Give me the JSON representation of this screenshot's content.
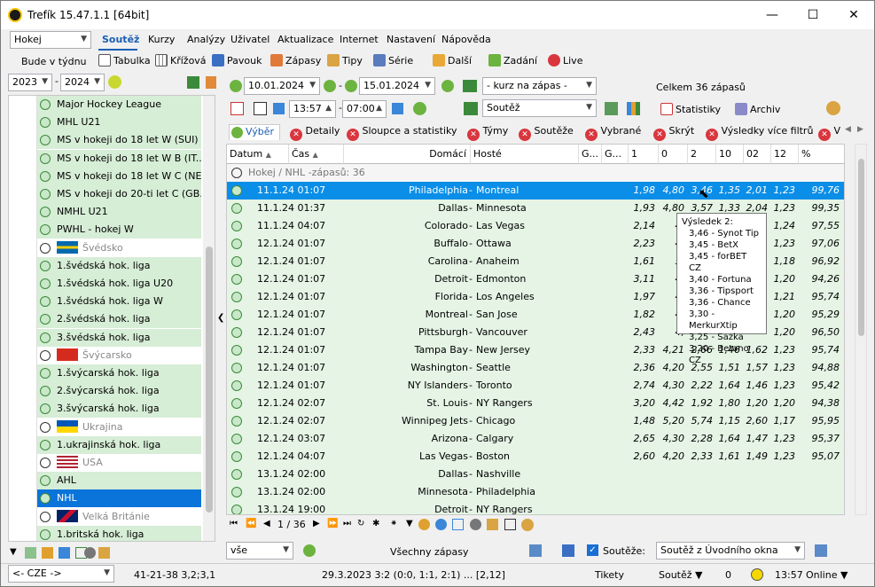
{
  "window": {
    "title": "Trefík 15.47.1.1 [64bit]",
    "minimize": "—",
    "maximize": "☐",
    "close": "✕"
  },
  "sport_select": "Hokej",
  "period_label": "Bude v týdnu",
  "menu": [
    "Soutěž",
    "Kurzy",
    "Analýzy",
    "Uživatel",
    "Aktualizace",
    "Internet",
    "Nastavení",
    "Nápověda"
  ],
  "toolbar1": [
    "Tabulka",
    "Křížová",
    "Pavouk",
    "Zápasy",
    "Tipy",
    "Série",
    "Další",
    "Zadání",
    "Live"
  ],
  "year_from": "2023",
  "year_to": "2024",
  "date_from": "10.01.2024",
  "date_to": "15.01.2024",
  "time_from": "13:57",
  "time_to": "07:00",
  "kurz_select": "- kurz na zápas -",
  "souteze_select": "Soutěž",
  "total_label": "Celkem 36 zápasů",
  "statistiky": "Statistiky",
  "archiv": "Archiv",
  "filters": [
    "Výběr",
    "Detaily",
    "Sloupce a statistiky",
    "Týmy",
    "Soutěže",
    "Vybrané",
    "Skrýt",
    "Výsledky více filtrů",
    "V"
  ],
  "left_list": [
    {
      "label": "Major Hockey League",
      "type": "league"
    },
    {
      "label": "MHL U21",
      "type": "league"
    },
    {
      "label": "MS v hokeji do 18 let W (SUI)",
      "type": "league"
    },
    {
      "label": "MS v hokeji do 18 let W B (IT...",
      "type": "league"
    },
    {
      "label": "MS v hokeji do 18 let W C (NE...",
      "type": "league"
    },
    {
      "label": "MS v hokeji do 20-ti let C (GB...",
      "type": "league"
    },
    {
      "label": "NMHL U21",
      "type": "league"
    },
    {
      "label": "PWHL - hokej W",
      "type": "league"
    },
    {
      "label": "Švédsko",
      "type": "country",
      "flag": "se"
    },
    {
      "label": "1.švédská hok. liga",
      "type": "league"
    },
    {
      "label": "1.švédská hok. liga U20",
      "type": "league"
    },
    {
      "label": "1.švédská hok. liga W",
      "type": "league"
    },
    {
      "label": "2.švédská hok. liga",
      "type": "league"
    },
    {
      "label": "3.švédská hok. liga",
      "type": "league"
    },
    {
      "label": "Švýcarsko",
      "type": "country",
      "flag": "ch"
    },
    {
      "label": "1.švýcarská hok. liga",
      "type": "league"
    },
    {
      "label": "2.švýcarská hok. liga",
      "type": "league"
    },
    {
      "label": "3.švýcarská hok. liga",
      "type": "league"
    },
    {
      "label": "Ukrajina",
      "type": "country",
      "flag": "ua"
    },
    {
      "label": "1.ukrajinská hok. liga",
      "type": "league"
    },
    {
      "label": "USA",
      "type": "country",
      "flag": "us"
    },
    {
      "label": "AHL",
      "type": "league"
    },
    {
      "label": "NHL",
      "type": "selected"
    },
    {
      "label": "Velká Británie",
      "type": "country",
      "flag": "gb"
    },
    {
      "label": "1.britská hok. liga",
      "type": "league"
    }
  ],
  "grid": {
    "group_label": "Hokej / NHL -zápasů: 36",
    "headers": [
      "Datum",
      "Čas",
      "Domácí",
      "Hosté",
      "G...",
      "G...",
      "1",
      "0",
      "2",
      "10",
      "02",
      "12",
      "%"
    ],
    "rows": [
      {
        "date": "11.1.24 01:07",
        "home": "Philadelphia",
        "away": "Montreal",
        "o": [
          "1,98",
          "4,80",
          "3,46",
          "1,35",
          "2,01",
          "1,23",
          "99,76"
        ]
      },
      {
        "date": "11.1.24 01:37",
        "home": "Dallas",
        "away": "Minnesota",
        "o": [
          "1,93",
          "4,80",
          "3,57",
          "1,33",
          "2,04",
          "1,23",
          "99,35"
        ]
      },
      {
        "date": "11.1.24 04:07",
        "home": "Colorado",
        "away": "Las Vegas",
        "o": [
          "2,14",
          "4,",
          "",
          "",
          "",
          "1,24",
          "97,55"
        ]
      },
      {
        "date": "12.1.24 01:07",
        "home": "Buffalo",
        "away": "Ottawa",
        "o": [
          "2,23",
          "4,",
          "",
          "",
          "",
          "1,23",
          "97,06"
        ]
      },
      {
        "date": "12.1.24 01:07",
        "home": "Carolina",
        "away": "Anaheim",
        "o": [
          "1,61",
          "5,",
          "",
          "",
          "",
          "1,18",
          "96,92"
        ]
      },
      {
        "date": "12.1.24 01:07",
        "home": "Detroit",
        "away": "Edmonton",
        "o": [
          "3,11",
          "4,",
          "",
          "",
          "",
          "1,20",
          "94,26"
        ]
      },
      {
        "date": "12.1.24 01:07",
        "home": "Florida",
        "away": "Los Angeles",
        "o": [
          "1,97",
          "4,",
          "",
          "",
          "",
          "1,21",
          "95,74"
        ]
      },
      {
        "date": "12.1.24 01:07",
        "home": "Montreal",
        "away": "San Jose",
        "o": [
          "1,82",
          "4,",
          "",
          "",
          "",
          "1,20",
          "95,29"
        ]
      },
      {
        "date": "12.1.24 01:07",
        "home": "Pittsburgh",
        "away": "Vancouver",
        "o": [
          "2,43",
          "4,",
          "",
          "",
          "",
          "1,20",
          "96,50"
        ]
      },
      {
        "date": "12.1.24 01:07",
        "home": "Tampa Bay",
        "away": "New Jersey",
        "o": [
          "2,33",
          "4,21",
          "2,66",
          "1,46",
          "1,62",
          "1,23",
          "95,74"
        ]
      },
      {
        "date": "12.1.24 01:07",
        "home": "Washington",
        "away": "Seattle",
        "o": [
          "2,36",
          "4,20",
          "2,55",
          "1,51",
          "1,57",
          "1,23",
          "94,88"
        ]
      },
      {
        "date": "12.1.24 01:07",
        "home": "NY Islanders",
        "away": "Toronto",
        "o": [
          "2,74",
          "4,30",
          "2,22",
          "1,64",
          "1,46",
          "1,23",
          "95,42"
        ]
      },
      {
        "date": "12.1.24 02:07",
        "home": "St. Louis",
        "away": "NY Rangers",
        "o": [
          "3,20",
          "4,42",
          "1,92",
          "1,80",
          "1,20",
          "1,20",
          "94,38"
        ]
      },
      {
        "date": "12.1.24 02:07",
        "home": "Winnipeg Jets",
        "away": "Chicago",
        "o": [
          "1,48",
          "5,20",
          "5,74",
          "1,15",
          "2,60",
          "1,17",
          "95,95"
        ]
      },
      {
        "date": "12.1.24 03:07",
        "home": "Arizona",
        "away": "Calgary",
        "o": [
          "2,65",
          "4,30",
          "2,28",
          "1,64",
          "1,47",
          "1,23",
          "95,37"
        ]
      },
      {
        "date": "12.1.24 04:07",
        "home": "Las Vegas",
        "away": "Boston",
        "o": [
          "2,60",
          "4,20",
          "2,33",
          "1,61",
          "1,49",
          "1,23",
          "95,07"
        ]
      },
      {
        "date": "13.1.24 02:00",
        "home": "Dallas",
        "away": "Nashville",
        "o": [
          "",
          "",
          "",
          "",
          "",
          "",
          ""
        ]
      },
      {
        "date": "13.1.24 02:00",
        "home": "Minnesota",
        "away": "Philadelphia",
        "o": [
          "",
          "",
          "",
          "",
          "",
          "",
          ""
        ]
      },
      {
        "date": "13.1.24 19:00",
        "home": "Detroit",
        "away": "NY Rangers",
        "o": [
          "",
          "",
          "",
          "",
          "",
          "",
          ""
        ]
      }
    ]
  },
  "tooltip": {
    "title": "Výsledek 2:",
    "lines": [
      "3,46 - Synot Tip",
      "3,45 - BetX",
      "3,45 - forBET CZ",
      "3,40 - Fortuna",
      "3,36 - Tipsport",
      "3,36 - Chance",
      "3,30 - MerkurXtip",
      "3,25 - Sazka",
      "3,20 - Betano CZ"
    ]
  },
  "pager": "1 / 36",
  "bottom": {
    "filter_select": "vše",
    "all_matches": "Všechny zápasy",
    "souteze_check": "Soutěže:",
    "souteze_from": "Soutěž z Úvodního okna"
  },
  "status": {
    "lang": "<- CZE ->",
    "record": "41-21-38  3,2;3,1",
    "last": "29.3.2023 3:2 (0:0, 1:1, 2:1) ... [2,12]",
    "tikety": "Tikety",
    "souteze": "Soutěž ▼",
    "count": "0",
    "time": "13:57",
    "online": "Online ▼"
  },
  "colors": {
    "selection": "#0a8ee8",
    "row_bg": "#e5f4e5",
    "accent_green": "#3b8a3b",
    "close_red": "#d9363e"
  }
}
